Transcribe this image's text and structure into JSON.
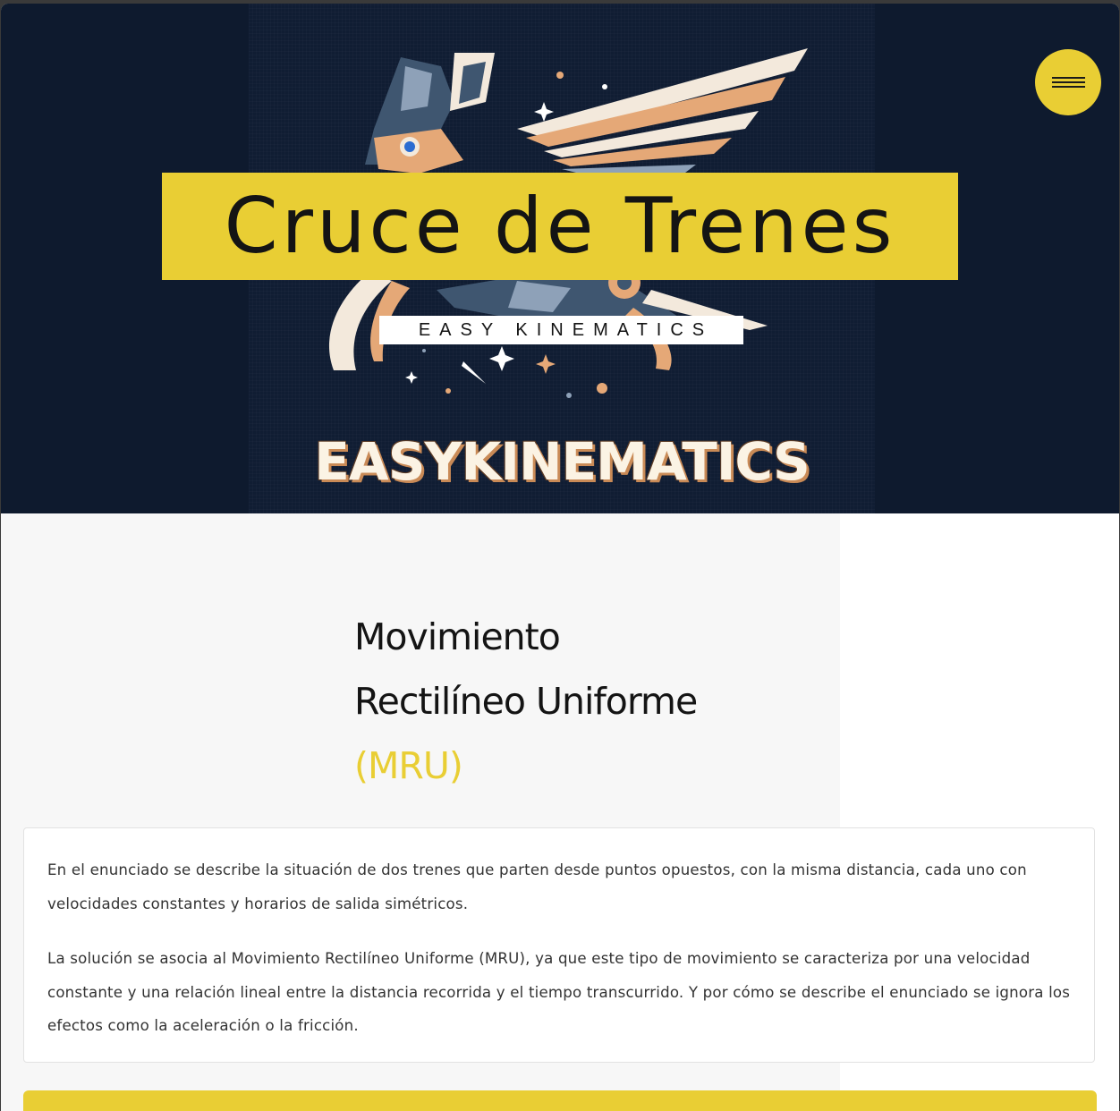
{
  "hero": {
    "title": "Cruce de Trenes",
    "subtitle": "EASY KINEMATICS",
    "brand_wordmark": "EASYKINEMATICS",
    "menu_icon": "hamburger-menu-icon"
  },
  "section": {
    "heading_line1": "Movimiento",
    "heading_line2": "Rectilíneo Uniforme",
    "heading_accent": "(MRU)"
  },
  "card": {
    "paragraph1": "En el enunciado se describe la situación de dos trenes que parten desde puntos opuestos, con la misma distancia, cada uno con velocidades constantes y horarios de salida simétricos.",
    "paragraph2": "La solución se asocia al Movimiento Rectilíneo Uniforme (MRU), ya que este tipo de movimiento se caracteriza por una velocidad constante y una relación lineal entre la distancia recorrida y el tiempo transcurrido. Y por cómo se describe el enunciado se ignora los efectos como la aceleración o la fricción."
  },
  "colors": {
    "accent": "#e9ce34",
    "hero_background": "#0e1a2e",
    "text": "#141414"
  }
}
